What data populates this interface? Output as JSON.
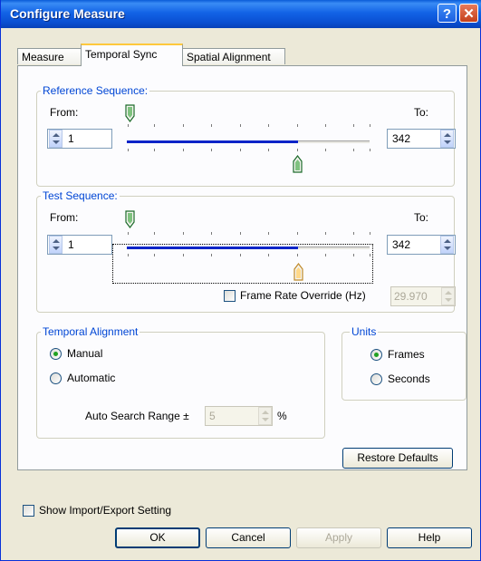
{
  "window": {
    "title": "Configure Measure",
    "help_glyph": "?",
    "close_glyph": "✕"
  },
  "tabs": [
    {
      "label": "Measure",
      "selected": false
    },
    {
      "label": "Temporal Sync",
      "selected": true
    },
    {
      "label": "Spatial Alignment",
      "selected": false
    }
  ],
  "reference": {
    "label": "Reference Sequence:",
    "from_label": "From:",
    "to_label": "To:",
    "from_value": "1",
    "to_value": "342"
  },
  "test": {
    "label": "Test Sequence:",
    "from_label": "From:",
    "to_label": "To:",
    "from_value": "1",
    "to_value": "342",
    "frame_rate_override_label": "Frame Rate Override (Hz)",
    "frame_rate_override_checked": false,
    "frame_rate_value": "29.970"
  },
  "temporal_alignment": {
    "label": "Temporal Alignment",
    "manual_label": "Manual",
    "automatic_label": "Automatic",
    "selected": "Manual",
    "auto_search_label": "Auto Search Range ±",
    "auto_search_value": "5",
    "auto_search_unit": "%"
  },
  "units": {
    "label": "Units",
    "frames_label": "Frames",
    "seconds_label": "Seconds",
    "selected": "Frames"
  },
  "buttons": {
    "restore_defaults": "Restore Defaults",
    "ok": "OK",
    "cancel": "Cancel",
    "apply": "Apply",
    "help": "Help"
  },
  "show_import_export_label": "Show Import/Export Setting",
  "show_import_export_checked": false
}
